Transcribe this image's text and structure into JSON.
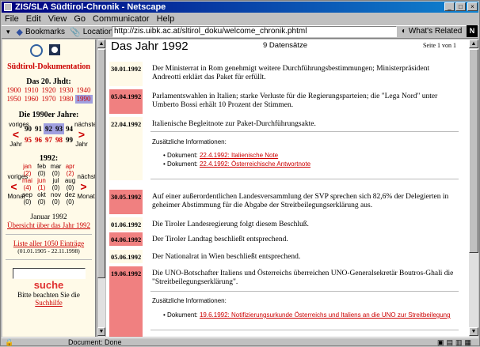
{
  "window": {
    "title": "ZIS/SLA Südtirol-Chronik - Netscape"
  },
  "menu": [
    "File",
    "Edit",
    "View",
    "Go",
    "Communicator",
    "Help"
  ],
  "toolbar": {
    "bookmarks": "Bookmarks",
    "location_label": "Location:",
    "url": "http://zis.uibk.ac.at/sltirol_doku/welcome_chronik.phtml",
    "related": "What's Related"
  },
  "sidebar": {
    "title": "Südtirol-Dokumentation",
    "decades_heading": "Das 20. Jhdt:",
    "decades": [
      [
        "1900",
        "1910",
        "1920",
        "1930",
        "1940"
      ],
      [
        "1950",
        "1960",
        "1970",
        "1980",
        "1990"
      ]
    ],
    "years_heading": "Die 1990er Jahre:",
    "prev_label": "voriges",
    "next_label": "nächstes",
    "jahr_label": "Jahr",
    "years_row1": [
      "90",
      "91",
      "92",
      "93",
      "94"
    ],
    "years_row2": [
      "95",
      "96",
      "97",
      "98",
      "99"
    ],
    "months_heading": "1992:",
    "months": [
      [
        "jan",
        "feb",
        "mar",
        "apr"
      ],
      [
        "(2)",
        "(0)",
        "(0)",
        "(2)"
      ],
      [
        "mai",
        "jun",
        "jul",
        "aug"
      ],
      [
        "(4)",
        "(1)",
        "(0)",
        "(0)"
      ],
      [
        "sep",
        "okt",
        "nov",
        "dez"
      ],
      [
        "(0)",
        "(0)",
        "(0)",
        "(0)"
      ]
    ],
    "monat_label": "Monat",
    "current": "Januar 1992",
    "overview_link": "Übersicht über das Jahr 1992",
    "list_link": "Liste aller 1050 Einträge",
    "list_range": "(01.01.1905 - 22.11.1998)",
    "search_label": "suche",
    "note": "Bitte beachten Sie die",
    "note_link": "Suchhilfe"
  },
  "main": {
    "heading": "Das Jahr 1992",
    "count": "9 Datensätze",
    "page": "Seite 1 von 1",
    "zus": "Zusätzliche Informationen:",
    "doc_label": "Dokument:",
    "entries": [
      {
        "date": "30.01.1992",
        "text": "Der Ministerrat in Rom genehmigt weitere Durchführungsbestimmungen; Ministerpräsident Andreotti erklärt das Paket für erfüllt."
      },
      {
        "date": "05.04.1992",
        "text": "Parlamentswahlen in Italien; starke Verluste für die Regierungsparteien; die \"Lega Nord\" unter Umberto Bossi erhält 10 Prozent der Stimmen."
      },
      {
        "date": "22.04.1992",
        "text": "Italienische Begleitnote zur Paket-Durchführungsakte.",
        "docs": [
          "22.4.1992: Italienische Note",
          "22.4.1992: Österreichische Antwortnote"
        ]
      },
      {
        "date": "30.05.1992",
        "text": "Auf einer außerordentlichen Landesversammlung der SVP sprechen sich 82,6% der Delegierten in geheimer Abstimmung für die Abgabe der Streitbeilegungserklärung aus."
      },
      {
        "date": "01.06.1992",
        "text": "Die Tiroler Landesregierung folgt diesem Beschluß."
      },
      {
        "date": "04.06.1992",
        "text": "Der Tiroler Landtag beschließt entsprechend."
      },
      {
        "date": "05.06.1992",
        "text": "Der Nationalrat in Wien beschließt entsprechend."
      },
      {
        "date": "19.06.1992",
        "text": "Die UNO-Botschafter Italiens und Österreichs überreichen UNO-Generalsekretär Boutros-Ghali die \"Streitbeilegungserklärung\".",
        "docs": [
          "19.6.1992: Notifizierungsurkunde Österreichs und Italiens an die UNO zur Streitbeilegung"
        ]
      }
    ]
  },
  "status": {
    "text": "Document: Done"
  }
}
